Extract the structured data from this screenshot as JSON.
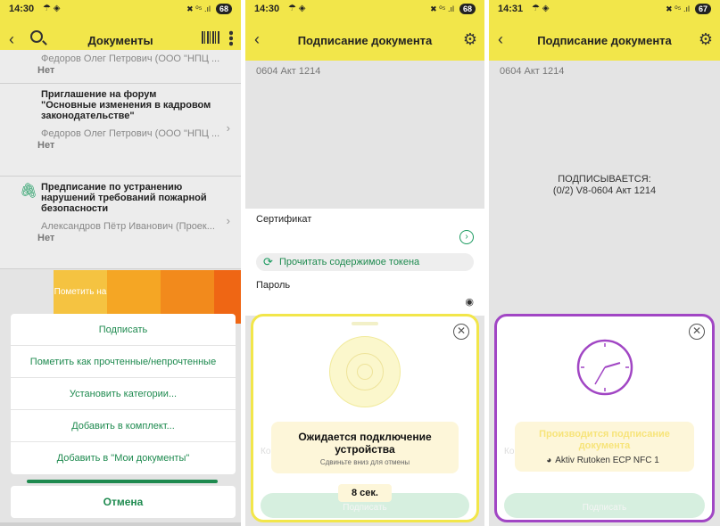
{
  "phone1": {
    "status": {
      "time": "14:30",
      "network": "☂ ◈",
      "signal": "✖ ⁰⁵ .ıl",
      "battery": "68"
    },
    "title": "Документы",
    "docs": [
      {
        "title": "",
        "author": "Федоров Олег Петрович (ООО \"НПЦ ...",
        "status": "Нет"
      },
      {
        "title": "Приглашение на форум \"Основные изменения в кадровом законодательстве\"",
        "author": "Федоров Олег Петрович (ООО \"НПЦ ...",
        "status": "Нет"
      },
      {
        "title": "Предписание по устранению нарушений требований пожарной безопасности",
        "author": "Александров Пётр Иванович (Проек...",
        "status": "Нет"
      }
    ],
    "swipe_action": "Пометить на",
    "menu": [
      "Подписать",
      "Пометить как прочтенные/непрочтенные",
      "Установить категории...",
      "Добавить в комплект...",
      "Добавить в \"Мои документы\""
    ],
    "cancel": "Отмена"
  },
  "phone2": {
    "status": {
      "time": "14:30",
      "network": "☂ ◈",
      "signal": "✖ ⁰⁵ .ıl",
      "battery": "68"
    },
    "title": "Подписание документа",
    "doc_name": "0604 Акт 1214",
    "certificate_label": "Сертификат",
    "token_button": "Прочитать содержимое токена",
    "password_label": "Пароль",
    "sheet": {
      "heading": "Ожидается подключение устройства",
      "subtext": "Сдвиньте вниз для отмены",
      "comment_hint": "Комментарий",
      "timer": "8 сек.",
      "sign_button": "Подписать"
    }
  },
  "phone3": {
    "status": {
      "time": "14:31",
      "network": "☂ ◈",
      "signal": "✖ ⁰⁵ .ıl",
      "battery": "67"
    },
    "title": "Подписание документа",
    "doc_name": "0604 Акт 1214",
    "status_text_1": "ПОДПИСЫВАЕТСЯ:",
    "status_text_2": "(0/2) V8-0604 Акт 1214",
    "sheet": {
      "heading": "Производится подписание документа",
      "comment_hint": "Комментарии",
      "device": "Aktiv Rutoken ECP NFC 1",
      "sign_button": "Подписать"
    }
  },
  "colors": {
    "accent_yellow": "#f2e64a",
    "green": "#1e8a4f",
    "purple": "#a146c4",
    "swipe_orange": "#f59a1a"
  },
  "icons": [
    "back-icon",
    "search-icon",
    "barcode-icon",
    "kebab-icon",
    "gear-icon",
    "paperclip-icon",
    "chevron-right-icon",
    "arrow-circle-icon",
    "refresh-icon",
    "eye-icon",
    "close-icon",
    "nfc-icon",
    "clock-icon",
    "globe-icon"
  ]
}
